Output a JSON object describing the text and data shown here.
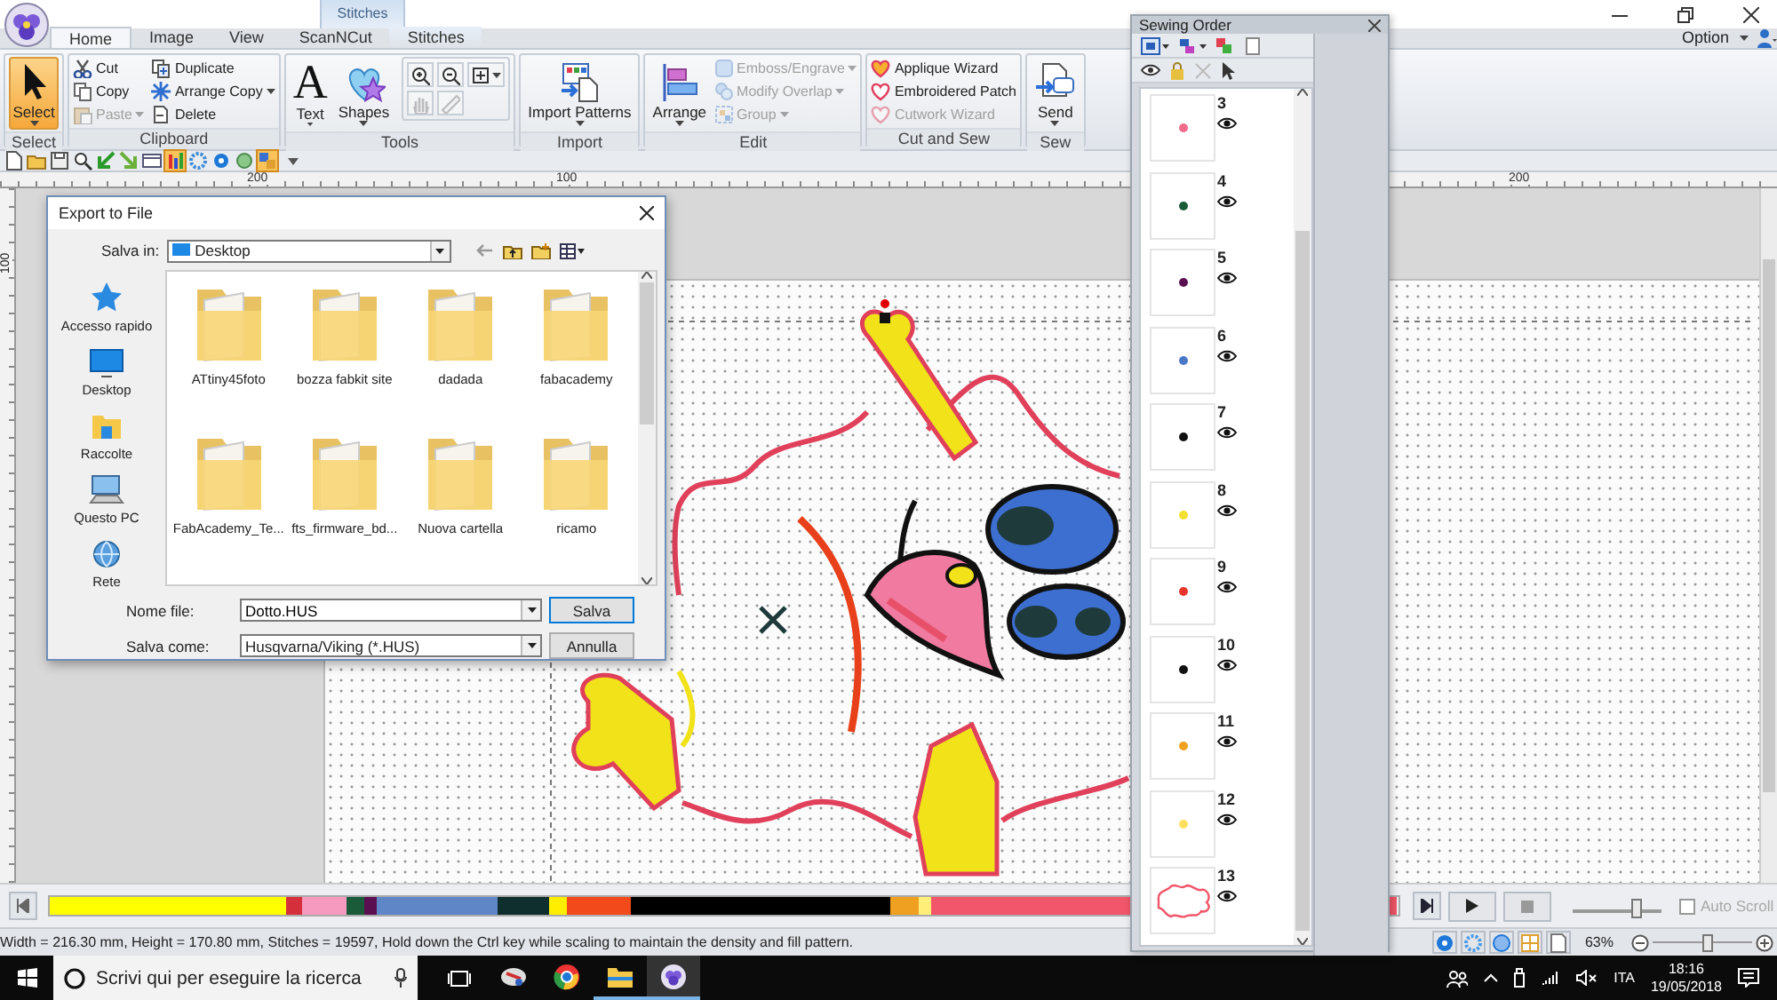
{
  "contextual_tab_header": "Stitches",
  "tabs": [
    {
      "label": "Home",
      "selected": true
    },
    {
      "label": "Image",
      "selected": false
    },
    {
      "label": "View",
      "selected": false
    },
    {
      "label": "ScanNCut",
      "selected": false
    },
    {
      "label": "Stitches",
      "selected": false
    }
  ],
  "option_menu": "Option",
  "ribbon": {
    "groups": [
      {
        "title": "Select",
        "large": [
          {
            "label": "Select",
            "selected": true,
            "dropdown": true,
            "disabled": false
          }
        ]
      },
      {
        "title": "Clipboard",
        "small": [
          {
            "label": "Cut",
            "dropdown": false,
            "disabled": false
          },
          {
            "label": "Copy",
            "dropdown": false,
            "disabled": false
          },
          {
            "label": "Paste",
            "dropdown": true,
            "disabled": true
          },
          {
            "label": "Duplicate",
            "dropdown": false,
            "disabled": false
          },
          {
            "label": "Arrange Copy",
            "dropdown": true,
            "disabled": false
          },
          {
            "label": "Delete",
            "dropdown": false,
            "disabled": false
          }
        ]
      },
      {
        "title": "Tools",
        "large": [
          {
            "label": "Text",
            "glyph": "A",
            "dropdown": true,
            "disabled": false
          },
          {
            "label": "Shapes",
            "dropdown": true,
            "disabled": false
          }
        ],
        "icon_buttons": [
          {
            "dropdown": false,
            "disabled": false
          },
          {
            "dropdown": false,
            "disabled": false
          },
          {
            "dropdown": true,
            "disabled": false
          },
          {
            "dropdown": false,
            "disabled": true
          },
          {
            "dropdown": false,
            "disabled": true
          }
        ]
      },
      {
        "title": "Import",
        "large": [
          {
            "label": "Import Patterns",
            "dropdown": true,
            "disabled": false
          }
        ]
      },
      {
        "title": "Edit",
        "large": [
          {
            "label": "Arrange",
            "dropdown": true,
            "disabled": false
          }
        ],
        "small": [
          {
            "label": "Emboss/Engrave",
            "dropdown": true,
            "disabled": true
          },
          {
            "label": "Modify Overlap",
            "dropdown": true,
            "disabled": true
          },
          {
            "label": "Group",
            "dropdown": true,
            "disabled": true
          }
        ]
      },
      {
        "title": "Cut and Sew",
        "small": [
          {
            "label": "Applique Wizard",
            "dropdown": false,
            "disabled": false
          },
          {
            "label": "Embroidered Patch",
            "dropdown": false,
            "disabled": false
          },
          {
            "label": "Cutwork Wizard",
            "dropdown": false,
            "disabled": true
          }
        ]
      },
      {
        "title": "Sew",
        "large": [
          {
            "label": "Send",
            "dropdown": true,
            "disabled": false
          }
        ]
      }
    ]
  },
  "quick_access_toolbar": [
    {
      "on": false
    },
    {
      "on": false
    },
    {
      "on": false
    },
    {
      "on": false
    },
    {
      "on": false
    },
    {
      "on": false
    },
    {
      "on": false
    },
    {
      "on": true
    },
    {
      "on": false
    },
    {
      "on": false
    },
    {
      "on": false
    },
    {
      "on": true
    }
  ],
  "rulers": {
    "horizontal_labels": [
      "200",
      "100",
      "200"
    ],
    "vertical_labels": [
      "100"
    ]
  },
  "export_dialog": {
    "title": "Export to File",
    "save_in_label": "Salva in:",
    "save_in_value": "Desktop",
    "places": [
      "Accesso rapido",
      "Desktop",
      "Raccolte",
      "Questo PC",
      "Rete"
    ],
    "files": [
      "ATtiny45foto",
      "bozza fabkit site",
      "dadada",
      "fabacademy",
      "FabAcademy_Te...",
      "fts_firmware_bd...",
      "Nuova cartella",
      "ricamo"
    ],
    "file_name_label": "Nome file:",
    "file_name": "Dotto.HUS",
    "save_as_label": "Salva come:",
    "save_as_value": "Husqvarna/Viking (*.HUS)",
    "buttons": [
      "Salva",
      "Annulla"
    ]
  },
  "sewing_order": {
    "title": "Sewing Order",
    "items": [
      {
        "number": "3",
        "color": "#f06a8a"
      },
      {
        "number": "4",
        "color": "#1a5c3a"
      },
      {
        "number": "5",
        "color": "#5a1050"
      },
      {
        "number": "6",
        "color": "#4a78c8"
      },
      {
        "number": "7",
        "color": "#111111"
      },
      {
        "number": "8",
        "color": "#f2e030"
      },
      {
        "number": "9",
        "color": "#e8342a"
      },
      {
        "number": "10",
        "color": "#111111"
      },
      {
        "number": "11",
        "color": "#f0a020"
      },
      {
        "number": "12",
        "color": "#ffe060"
      },
      {
        "number": "13",
        "color": "#f2566a"
      }
    ]
  },
  "color_bar": {
    "segments": [
      {
        "color": "#ffff00"
      },
      {
        "color": "#d62f3c"
      },
      {
        "color": "#f79ac0"
      },
      {
        "color": "#1a5c3a"
      },
      {
        "color": "#5a1050"
      },
      {
        "color": "#5f86c6"
      },
      {
        "color": "#0f2e2e"
      },
      {
        "color": "#ffee00"
      },
      {
        "color": "#f24a1a"
      },
      {
        "color": "#000000"
      },
      {
        "color": "#f0a020"
      },
      {
        "color": "#ffee77"
      },
      {
        "color": "#f2566a"
      }
    ]
  },
  "speed_slider": {
    "level": 0.72
  },
  "auto_scroll": {
    "label": "Auto Scroll",
    "checked": false,
    "disabled": true
  },
  "status_text": "Width = 216.30 mm, Height = 170.80 mm, Stitches = 19597, Hold down the Ctrl key while scaling to maintain the density and fill pattern.",
  "zoom": {
    "reading": "63%",
    "level": 0.55
  },
  "taskbar": {
    "search_placeholder": "Scrivi qui per eseguire la ricerca",
    "apps": [
      {
        "running": false,
        "active": false
      },
      {
        "running": false,
        "active": false
      },
      {
        "running": true,
        "active": false
      },
      {
        "running": true,
        "active": true
      }
    ],
    "language": "ITA",
    "time": "18:16",
    "date": "19/05/2018"
  }
}
